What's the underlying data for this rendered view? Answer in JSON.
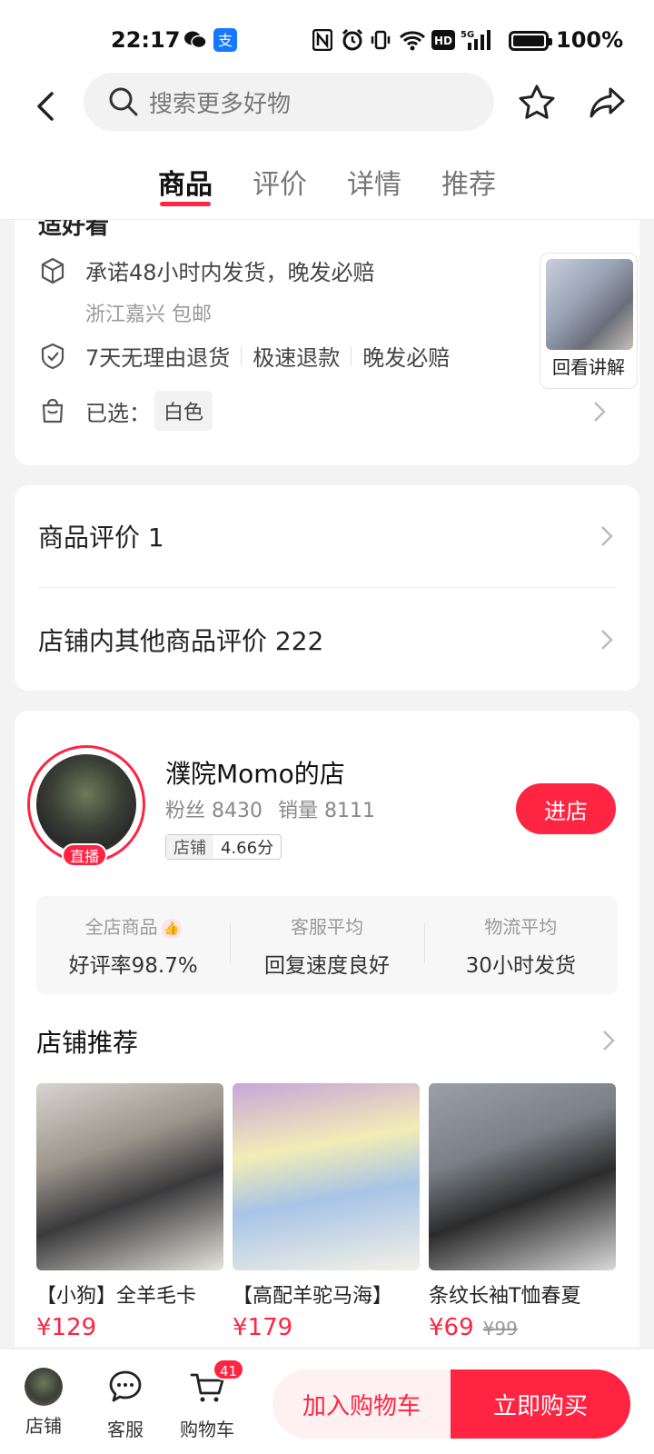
{
  "status_bar": {
    "time": "22:17",
    "battery_text": "100%",
    "battery_level": 1.0,
    "icons": [
      "wechat-icon",
      "alipay-icon",
      "nfc-icon",
      "alarm-icon",
      "vibrate-icon",
      "wifi-icon",
      "hd-icon",
      "5g-signal-icon",
      "battery-icon"
    ]
  },
  "header": {
    "search_placeholder": "搜索更多好物"
  },
  "tabs": [
    {
      "label": "商品",
      "active": true
    },
    {
      "label": "评价",
      "active": false
    },
    {
      "label": "详情",
      "active": false
    },
    {
      "label": "推荐",
      "active": false
    }
  ],
  "service": {
    "cut_title": "适好看",
    "shipping_promise": "承诺48小时内发货，晚发必赔",
    "shipping_origin": "浙江嘉兴 包邮",
    "guarantees": [
      "7天无理由退货",
      "极速退款",
      "晚发必赔"
    ],
    "selected_label": "已选：",
    "selected_value": "白色",
    "live_replay_label": "回看讲解"
  },
  "reviews": {
    "product_reviews": "商品评价 1",
    "shop_reviews": "店铺内其他商品评价 222"
  },
  "shop": {
    "name": "濮院Momo的店",
    "live_badge": "直播",
    "followers_label": "粉丝 8430",
    "sales_label": "销量 8111",
    "score_key": "店铺",
    "score_value": "4.66分",
    "enter_label": "进店",
    "metrics": [
      {
        "label": "全店商品",
        "value": "好评率98.7%"
      },
      {
        "label": "客服平均",
        "value": "回复速度良好"
      },
      {
        "label": "物流平均",
        "value": "30小时发货"
      }
    ],
    "recommend_title": "店铺推荐",
    "products": [
      {
        "name": "【小狗】全羊毛卡",
        "price": "¥129",
        "original_price": ""
      },
      {
        "name": "【高配羊驼马海】",
        "price": "¥179",
        "original_price": ""
      },
      {
        "name": "条纹长袖T恤春夏",
        "price": "¥69",
        "original_price": "¥99"
      }
    ]
  },
  "bottom_bar": {
    "shop_label": "店铺",
    "service_label": "客服",
    "cart_label": "购物车",
    "cart_count": "41",
    "add_to_cart": "加入购物车",
    "buy_now": "立即购买"
  },
  "colors": {
    "accent": "#ff2442"
  }
}
